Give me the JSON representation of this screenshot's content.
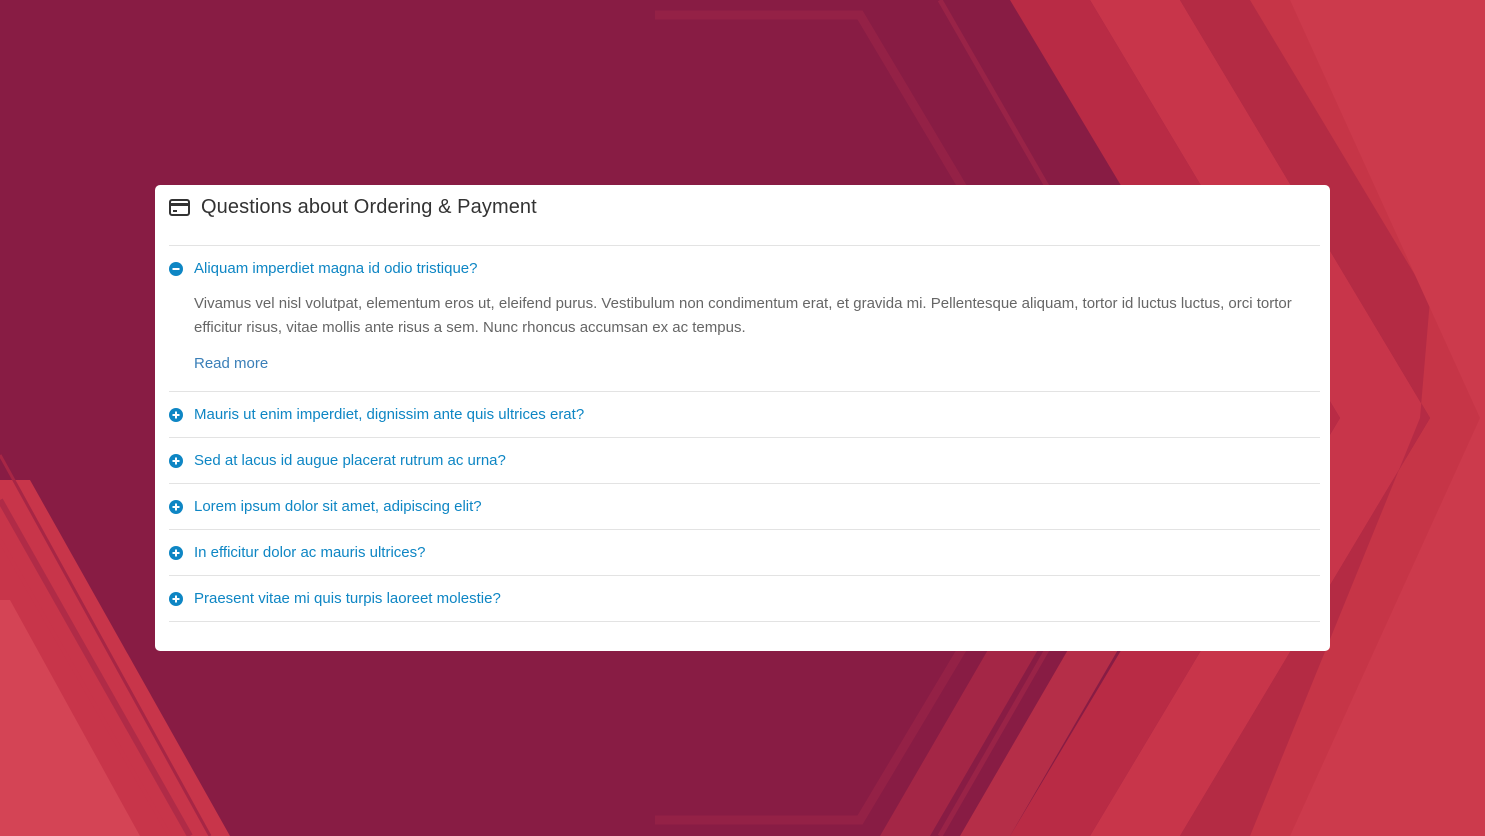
{
  "panel": {
    "icon": "credit-card-icon",
    "title": "Questions about Ordering & Payment"
  },
  "faq": {
    "items": [
      {
        "question": "Aliquam imperdiet magna id odio tristique?",
        "expanded": true,
        "icon": "minus-circle-icon",
        "answer": "Vivamus vel nisl volutpat, elementum eros ut, eleifend purus. Vestibulum non condimentum erat, et gravida mi. Pellentesque aliquam, tortor id luctus luctus, orci tortor efficitur risus, vitae mollis ante risus a sem. Nunc rhoncus accumsan ex ac tempus.",
        "link_label": "Read more"
      },
      {
        "question": "Mauris ut enim imperdiet, dignissim ante quis ultrices erat?",
        "expanded": false,
        "icon": "plus-circle-icon"
      },
      {
        "question": "Sed at lacus id augue placerat rutrum ac urna?",
        "expanded": false,
        "icon": "plus-circle-icon"
      },
      {
        "question": "Lorem ipsum dolor sit amet, adipiscing elit?",
        "expanded": false,
        "icon": "plus-circle-icon"
      },
      {
        "question": "In efficitur dolor ac mauris ultrices?",
        "expanded": false,
        "icon": "plus-circle-icon"
      },
      {
        "question": "Praesent vitae mi quis turpis laoreet molestie?",
        "expanded": false,
        "icon": "plus-circle-icon"
      }
    ]
  },
  "colors": {
    "background": "#881c44",
    "accent_red": "#c8354a",
    "link": "#0e86c4",
    "card": "#ffffff"
  }
}
